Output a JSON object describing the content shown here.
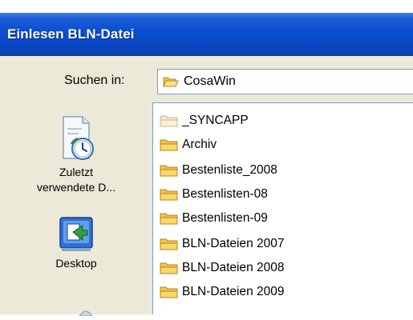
{
  "window": {
    "title": "Einlesen BLN-Datei"
  },
  "lookin": {
    "label": "Suchen in:",
    "value": "CosaWin"
  },
  "places": [
    {
      "label": "Zuletzt verwendete D...",
      "icon": "recent-documents-icon"
    },
    {
      "label": "Desktop",
      "icon": "desktop-icon"
    }
  ],
  "files": [
    {
      "name": "_SYNCAPP",
      "hidden": true
    },
    {
      "name": "Archiv",
      "hidden": false
    },
    {
      "name": "Bestenliste_2008",
      "hidden": false
    },
    {
      "name": "Bestenlisten-08",
      "hidden": false
    },
    {
      "name": "Bestenlisten-09",
      "hidden": false
    },
    {
      "name": "BLN-Dateien 2007",
      "hidden": false
    },
    {
      "name": "BLN-Dateien 2008",
      "hidden": false
    },
    {
      "name": "BLN-Dateien 2009",
      "hidden": false
    }
  ],
  "colors": {
    "titlebar": "#0a4fd1",
    "dialog": "#ece9d8",
    "folder": "#f5c242",
    "folder_hidden": "#f3e8c4"
  }
}
